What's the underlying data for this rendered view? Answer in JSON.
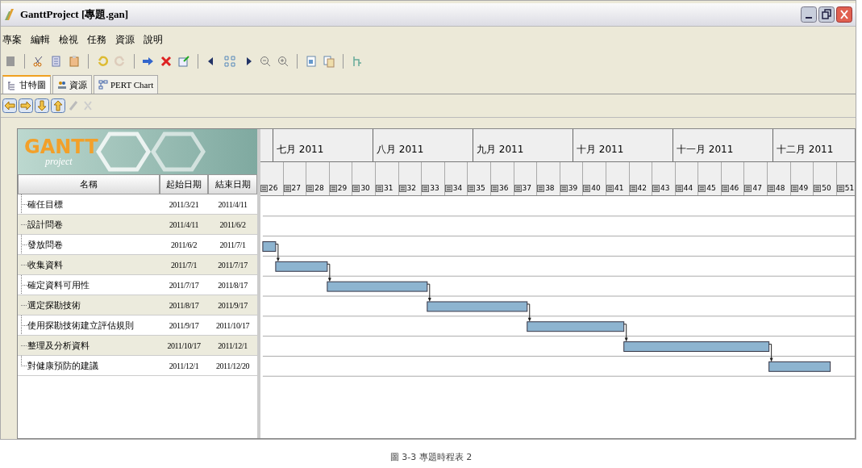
{
  "window": {
    "title": "GanttProject [專題.gan]"
  },
  "menu": [
    "專案",
    "編輯",
    "檢視",
    "任務",
    "資源",
    "說明"
  ],
  "tabs": [
    {
      "label": "甘特圖",
      "selected": true,
      "kind": "gantt"
    },
    {
      "label": "資源",
      "selected": false,
      "kind": "resource"
    },
    {
      "label": "PERT Chart",
      "selected": false,
      "kind": "pert"
    }
  ],
  "logo": {
    "title": "GANTT",
    "subtitle": "project"
  },
  "table": {
    "columns": [
      "名稱",
      "起始日期",
      "結束日期"
    ],
    "rows": [
      {
        "name": "確任目標",
        "start": "2011/3/21",
        "end": "2011/4/11"
      },
      {
        "name": "設計問卷",
        "start": "2011/4/11",
        "end": "2011/6/2"
      },
      {
        "name": "發放問卷",
        "start": "2011/6/2",
        "end": "2011/7/1"
      },
      {
        "name": "收集資料",
        "start": "2011/7/1",
        "end": "2011/7/17"
      },
      {
        "name": "確定資料可用性",
        "start": "2011/7/17",
        "end": "2011/8/17"
      },
      {
        "name": "選定探勘技術",
        "start": "2011/8/17",
        "end": "2011/9/17"
      },
      {
        "name": "使用探勘技術建立評估規則",
        "start": "2011/9/17",
        "end": "2011/10/17"
      },
      {
        "name": "整理及分析資料",
        "start": "2011/10/17",
        "end": "2011/12/1"
      },
      {
        "name": "對健康預防的建議",
        "start": "2011/12/1",
        "end": "2011/12/20"
      }
    ]
  },
  "timeline": {
    "months": [
      "七月 2011",
      "八月 2011",
      "九月 2011",
      "十月 2011",
      "十一月 2011",
      "十二月 2011"
    ],
    "weeks": [
      "26",
      "27",
      "28",
      "29",
      "30",
      "31",
      "32",
      "33",
      "34",
      "35",
      "36",
      "37",
      "38",
      "39",
      "40",
      "41",
      "42",
      "43",
      "44",
      "45",
      "46",
      "47",
      "48",
      "49",
      "50",
      "51"
    ]
  },
  "caption": "圖 3-3 專題時程表 2"
}
